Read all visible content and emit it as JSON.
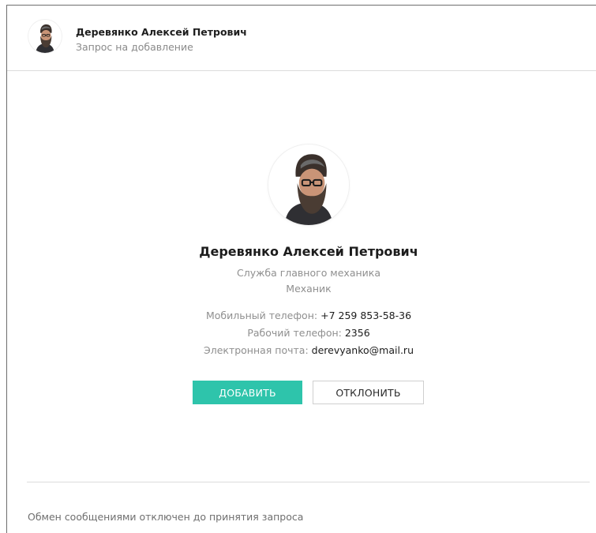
{
  "header": {
    "name": "Деревянко Алексей Петрович",
    "status": "Запрос на добавление"
  },
  "profile": {
    "name": "Деревянко Алексей Петрович",
    "department": "Служба главного механика",
    "position": "Механик",
    "mobile_label": "Мобильный телефон:",
    "mobile_value": "+7  259 853-58-36",
    "work_label": "Рабочий телефон:",
    "work_value": "2356",
    "email_label": "Электронная почта:",
    "email_value": "derevyanko@mail.ru"
  },
  "actions": {
    "add_label": "ДОБАВИТЬ",
    "decline_label": "ОТКЛОНИТЬ"
  },
  "footer": {
    "note": "Обмен сообщениями отключен до принятия запроса"
  },
  "colors": {
    "accent": "#2ec4ab",
    "muted_text": "#8f8f8f",
    "divider": "#dcdcdc"
  },
  "icons": {
    "header_avatar": "bearded-man-avatar-icon",
    "profile_avatar": "bearded-man-avatar-icon"
  }
}
